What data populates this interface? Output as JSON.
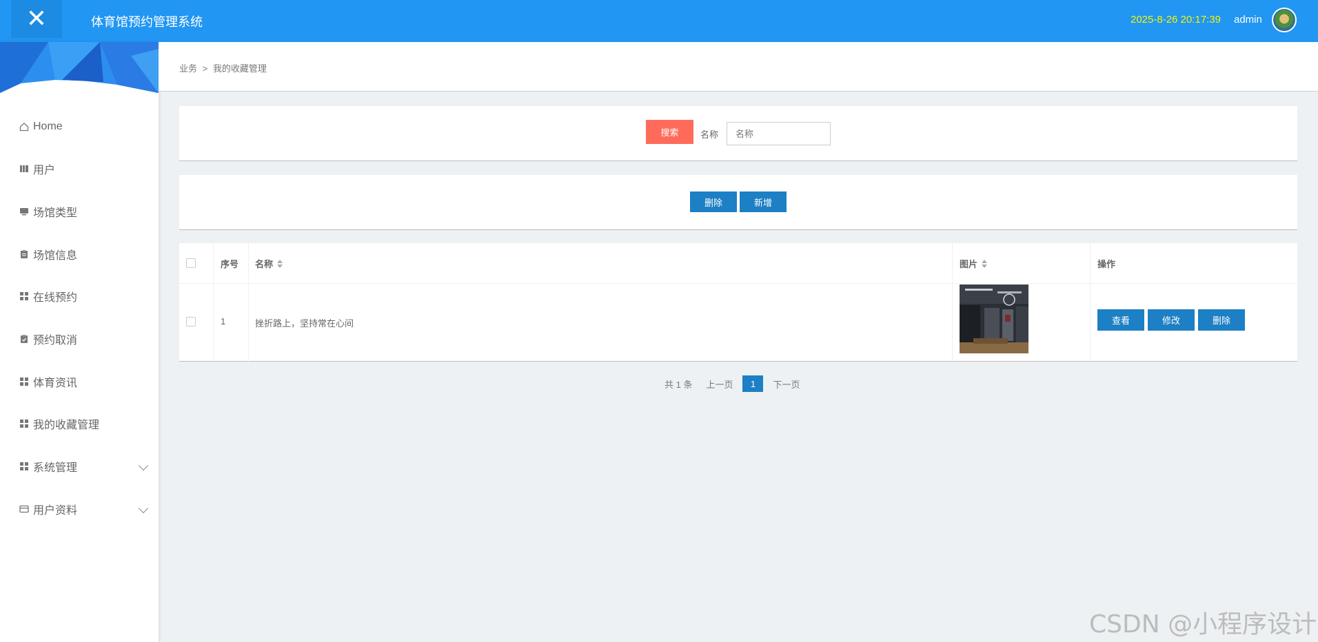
{
  "header": {
    "close_icon": "close-icon",
    "title": "体育馆预约管理系统",
    "datetime": "2025-8-26 20:17:39",
    "username": "admin",
    "avatar": "user-avatar",
    "colors": {
      "bar": "#2196f3",
      "datetime": "#f7f400"
    }
  },
  "sidebar": {
    "items": [
      {
        "label": "Home",
        "icon": "home-icon"
      },
      {
        "label": "用户",
        "icon": "book-icon"
      },
      {
        "label": "场馆类型",
        "icon": "monitor-icon"
      },
      {
        "label": "场馆信息",
        "icon": "clipboard-icon"
      },
      {
        "label": "在线预约",
        "icon": "grid-icon"
      },
      {
        "label": "预约取消",
        "icon": "clipboard-check-icon"
      },
      {
        "label": "体育资讯",
        "icon": "grid-icon"
      },
      {
        "label": "我的收藏管理",
        "icon": "grid-icon"
      },
      {
        "label": "系统管理",
        "icon": "grid-icon",
        "expandable": true
      },
      {
        "label": "用户资料",
        "icon": "card-icon",
        "expandable": true
      }
    ]
  },
  "breadcrumb": {
    "root": "业务",
    "separator": ">",
    "current": "我的收藏管理"
  },
  "search": {
    "button_label": "搜索",
    "field_label": "名称",
    "placeholder": "名称",
    "value": ""
  },
  "actions": {
    "delete_label": "删除",
    "add_label": "新增"
  },
  "table": {
    "headers": {
      "index": "序号",
      "name": "名称",
      "image": "图片",
      "operations": "操作"
    },
    "rows": [
      {
        "index": "1",
        "name": "挫折路上，坚持常在心间",
        "image": "gym-interior-thumbnail",
        "view_label": "查看",
        "edit_label": "修改",
        "delete_label": "删除"
      }
    ]
  },
  "pagination": {
    "total_text": "共 1 条",
    "prev_label": "上一页",
    "current_page": "1",
    "next_label": "下一页"
  },
  "colors": {
    "search_button": "#ff6b5b",
    "primary_button": "#1d7fc4"
  },
  "watermark": "CSDN @小程序设计"
}
